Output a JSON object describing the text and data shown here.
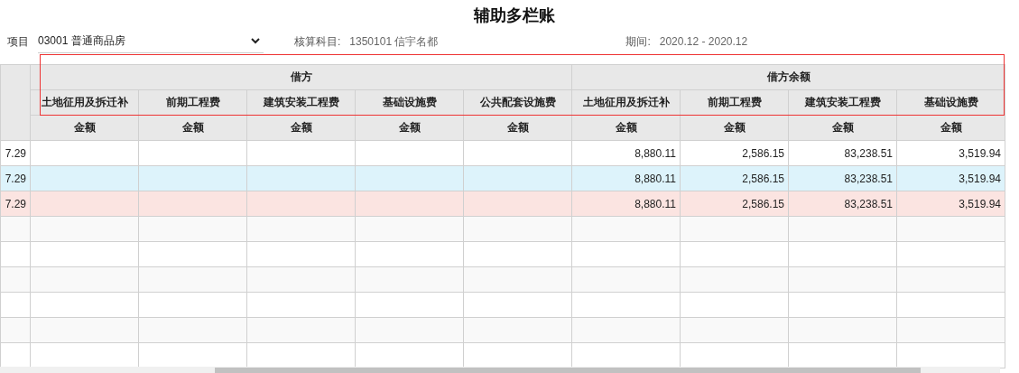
{
  "title": "辅助多栏账",
  "filters": [
    {
      "kind": "select",
      "label": "项目",
      "value": "03001 普通商品房"
    },
    {
      "kind": "info",
      "label": "核算科目:",
      "value": "1350101 信宇名都"
    },
    {
      "kind": "info",
      "label": "期间:",
      "value": "2020.12 - 2020.12"
    }
  ],
  "table": {
    "groups": [
      {
        "label": "借方",
        "columns": [
          {
            "label": "土地征用及拆迁补",
            "sub": "金额"
          },
          {
            "label": "前期工程费",
            "sub": "金额"
          },
          {
            "label": "建筑安装工程费",
            "sub": "金额"
          },
          {
            "label": "基础设施费",
            "sub": "金额"
          },
          {
            "label": "公共配套设施费",
            "sub": "金额"
          }
        ]
      },
      {
        "label": "借方余额",
        "columns": [
          {
            "label": "土地征用及拆迁补",
            "sub": "金额"
          },
          {
            "label": "前期工程费",
            "sub": "金额"
          },
          {
            "label": "建筑安装工程费",
            "sub": "金额"
          },
          {
            "label": "基础设施费",
            "sub": "金额"
          }
        ]
      }
    ],
    "rows": [
      {
        "lead": "7.29",
        "debit": [],
        "balance": [
          "8,880.11",
          "2,586.15",
          "83,238.51",
          "3,519.94"
        ],
        "selected": false,
        "hovered": false
      },
      {
        "lead": "7.29",
        "debit": [],
        "balance": [
          "8,880.11",
          "2,586.15",
          "83,238.51",
          "3,519.94"
        ],
        "selected": true,
        "hovered": false
      },
      {
        "lead": "7.29",
        "debit": [],
        "balance": [
          "8,880.11",
          "2,586.15",
          "83,238.51",
          "3,519.94"
        ],
        "selected": false,
        "hovered": true
      }
    ]
  }
}
